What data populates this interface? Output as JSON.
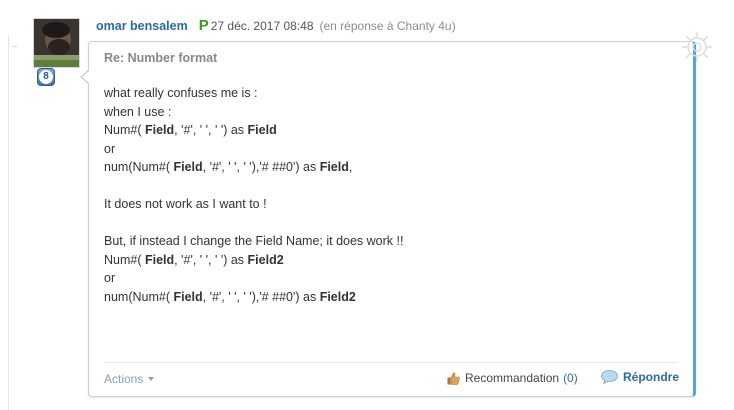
{
  "post": {
    "author": "omar bensalem",
    "badge": "P",
    "date": "27 déc. 2017 08:48",
    "reply_to": "(en réponse à Chanty 4u)",
    "rank": "8",
    "title": "Re: Number format",
    "body_lines": [
      [
        {
          "t": "what really confuses me is :",
          "b": false
        }
      ],
      [
        {
          "t": "when I use :",
          "b": false
        }
      ],
      [
        {
          "t": "Num#( ",
          "b": false
        },
        {
          "t": "Field",
          "b": true
        },
        {
          "t": ", '#', ' ', ' ') as ",
          "b": false
        },
        {
          "t": "Field",
          "b": true
        }
      ],
      [
        {
          "t": "or",
          "b": false
        }
      ],
      [
        {
          "t": "num(Num#( ",
          "b": false
        },
        {
          "t": "Field",
          "b": true
        },
        {
          "t": ", '#', ' ', ' '),'# ##0') as ",
          "b": false
        },
        {
          "t": "Field",
          "b": true
        },
        {
          "t": ",",
          "b": false
        }
      ],
      [],
      [
        {
          "t": "It does not work as I want to !",
          "b": false
        }
      ],
      [],
      [
        {
          "t": "But, if instead I change the Field Name; it does work !!",
          "b": false
        }
      ],
      [
        {
          "t": "Num#( ",
          "b": false
        },
        {
          "t": "Field",
          "b": true
        },
        {
          "t": ", '#', ' ', ' ') as ",
          "b": false
        },
        {
          "t": "Field2",
          "b": true
        }
      ],
      [
        {
          "t": "or",
          "b": false
        }
      ],
      [
        {
          "t": "num(Num#( ",
          "b": false
        },
        {
          "t": "Field",
          "b": true
        },
        {
          "t": ", '#', ' ', ' '),'# ##0') as ",
          "b": false
        },
        {
          "t": "Field2",
          "b": true
        }
      ]
    ]
  },
  "footer": {
    "actions_label": "Actions",
    "recommend_label": "Recommandation",
    "recommend_count": "(0)",
    "reply_label": "Répondre"
  },
  "icons": {
    "avatar": "user-avatar",
    "rank": "rank-badge-icon",
    "gear": "gear-watermark-icon",
    "thumb": "thumbs-up-icon",
    "reply": "speech-bubble-icon"
  },
  "colors": {
    "author_link": "#2b6aa3",
    "badge_green": "#3f9a1a",
    "bubble_accent": "#58a3d8",
    "muted_text": "#888888"
  }
}
